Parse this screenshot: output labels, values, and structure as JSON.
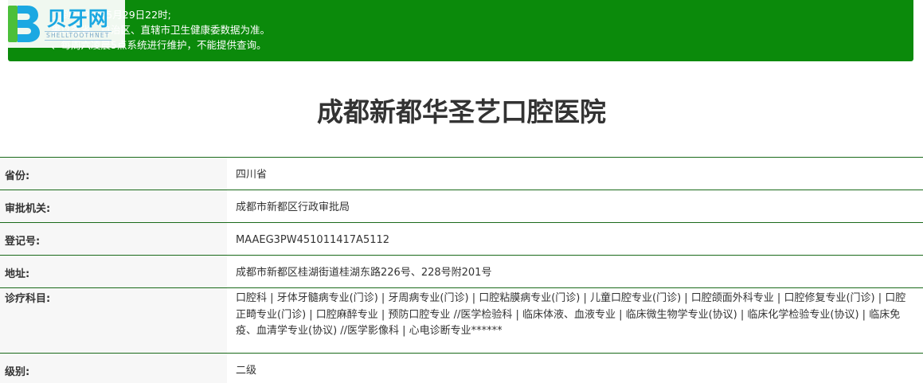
{
  "notice": {
    "lines": [
      "上到2022年5月29日22时;",
      "果以各省、自治区、直辖市卫生健康委数据为准。",
      "、每周六凌晨5点系统进行维护，不能提供查询。"
    ],
    "background_color": "#0b8a0b"
  },
  "logo": {
    "name_cn": "贝牙网",
    "name_en": "SHELLTOOTHNET",
    "brand_color": "#1ba8e2"
  },
  "page_title": "成都新都华圣艺口腔医院",
  "fields": [
    {
      "label": "省份:",
      "value": "四川省"
    },
    {
      "label": "审批机关:",
      "value": "成都市新都区行政审批局"
    },
    {
      "label": "登记号:",
      "value": "MAAEG3PW451011417A5112"
    },
    {
      "label": "地址:",
      "value": "成都市新都区桂湖街道桂湖东路226号、228号附201号"
    },
    {
      "label": "诊疗科目:",
      "value": "口腔科 | 牙体牙髓病专业(门诊) | 牙周病专业(门诊) | 口腔粘膜病专业(门诊) | 儿童口腔专业(门诊) | 口腔颌面外科专业 | 口腔修复专业(门诊) | 口腔正畸专业(门诊) | 口腔麻醉专业 | 预防口腔专业 //医学检验科 | 临床体液、血液专业 | 临床微生物学专业(协议) | 临床化学检验专业(协议) | 临床免疫、血清学专业(协议) //医学影像科 | 心电诊断专业******"
    },
    {
      "label": "级别:",
      "value": "二级"
    }
  ],
  "border_color": "#1a6a1a"
}
